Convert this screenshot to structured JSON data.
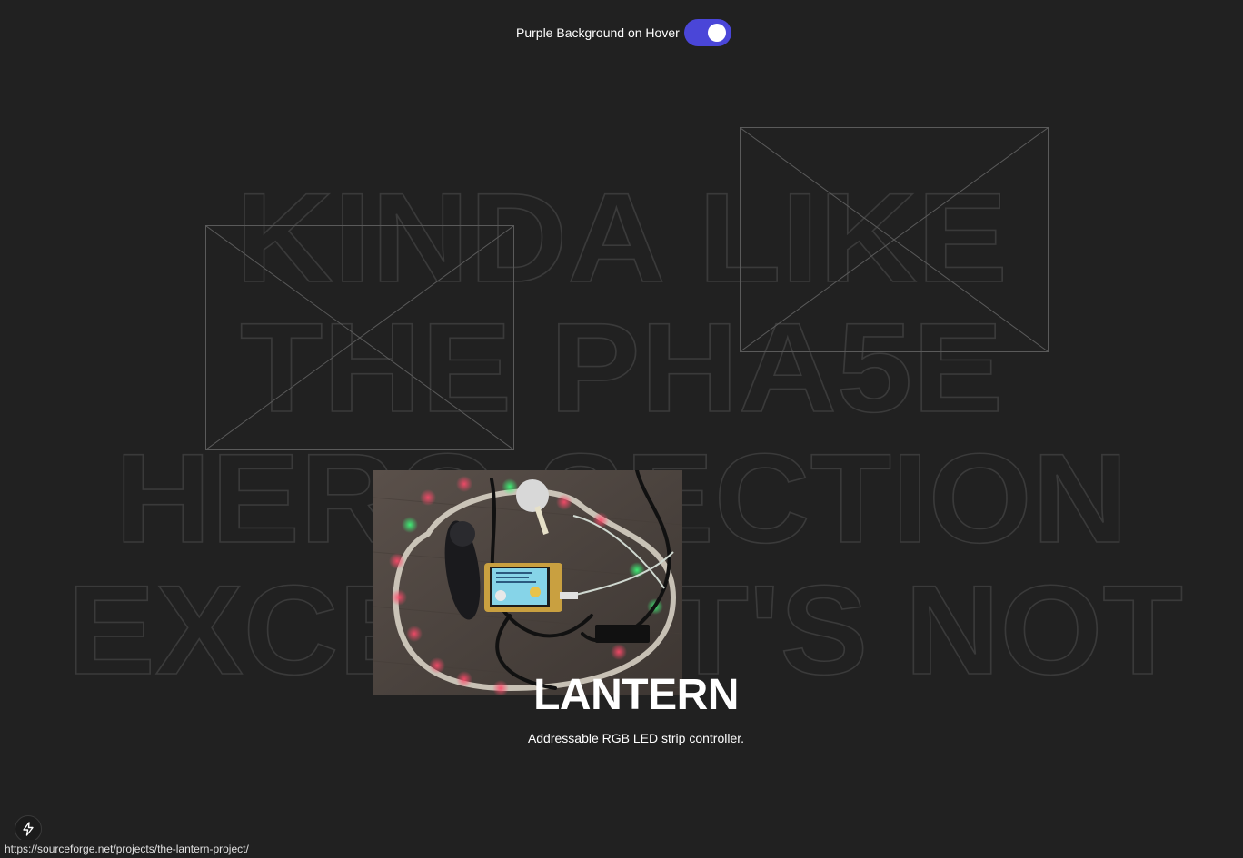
{
  "toggle": {
    "label": "Purple Background on Hover",
    "on": true,
    "color": "#4a46d8"
  },
  "hero": {
    "lines": [
      "KINDA LIKE",
      "THE PHA5E",
      "HERO SECTION",
      "EXCEPT IT'S NOT"
    ]
  },
  "project": {
    "title": "LANTERN",
    "description": "Addressable RGB LED strip controller."
  },
  "status_bar": {
    "url": "https://sourceforge.net/projects/the-lantern-project/"
  },
  "icons": {
    "bolt": "lightning-bolt-icon",
    "broken_image": "broken-image-icon"
  }
}
